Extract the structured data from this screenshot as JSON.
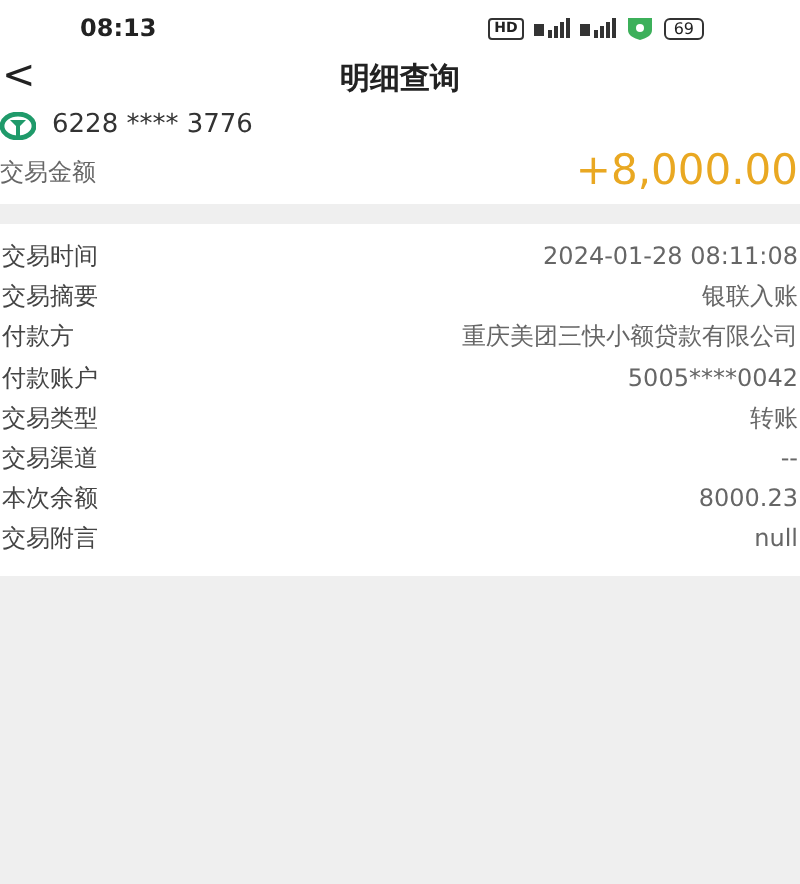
{
  "status_bar": {
    "time": "08:13",
    "hd_badge": "HD",
    "battery": "69"
  },
  "header": {
    "back": "<",
    "title": "明细查询"
  },
  "account": {
    "card_number": "6228 **** 3776"
  },
  "amount": {
    "label": "交易金额",
    "value": "+8,000.00"
  },
  "details": [
    {
      "label": "交易时间",
      "value": "2024-01-28 08:11:08"
    },
    {
      "label": "交易摘要",
      "value": "银联入账"
    },
    {
      "label": "付款方",
      "value": "重庆美团三快小额贷款有限公司"
    },
    {
      "label": "付款账户",
      "value": "5005****0042"
    },
    {
      "label": "交易类型",
      "value": "转账"
    },
    {
      "label": "交易渠道",
      "value": "--"
    },
    {
      "label": "本次余额",
      "value": "8000.23"
    },
    {
      "label": "交易附言",
      "value": "null"
    }
  ]
}
